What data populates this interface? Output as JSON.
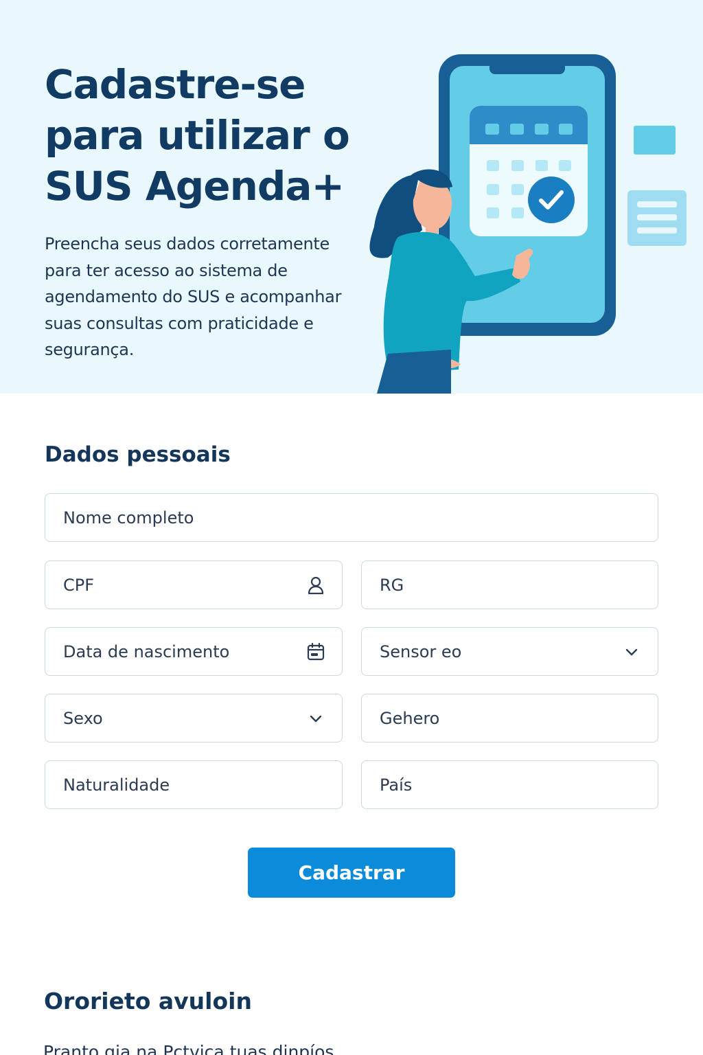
{
  "hero": {
    "title": "Cadastre-se para utilizar o SUS Agenda+",
    "description": "Preencha seus dados corretamente para ter acesso ao sistema de agendamento do SUS e acompanhar suas consultas com praticidade e segurança.",
    "illustration": "woman-pointing-at-phone-calendar-illustration"
  },
  "form": {
    "section_title": "Dados pessoais",
    "fields": {
      "nome": {
        "placeholder": "Nome completo"
      },
      "cpf": {
        "placeholder": "CPF",
        "icon": "user-icon"
      },
      "rg": {
        "placeholder": "RG"
      },
      "data_nascimento": {
        "placeholder": "Data de nascimento",
        "icon": "calendar-icon"
      },
      "sensor": {
        "placeholder": "Sensor eo",
        "icon": "chevron-down-icon"
      },
      "sexo": {
        "placeholder": "Sexo",
        "icon": "chevron-down-icon"
      },
      "genero": {
        "placeholder": "Gehero"
      },
      "naturalidade": {
        "placeholder": "Naturalidade"
      },
      "pais": {
        "placeholder": "País"
      }
    },
    "submit_label": "Cadastrar"
  },
  "section2": {
    "title": "Ororieto avuloin",
    "text": "Pranto gia na Pctvica tuas dinpíos"
  },
  "colors": {
    "hero_bg": "#e9f8fd",
    "primary": "#0b8bd9",
    "heading": "#123b63",
    "field_border": "#cdd7e1"
  }
}
